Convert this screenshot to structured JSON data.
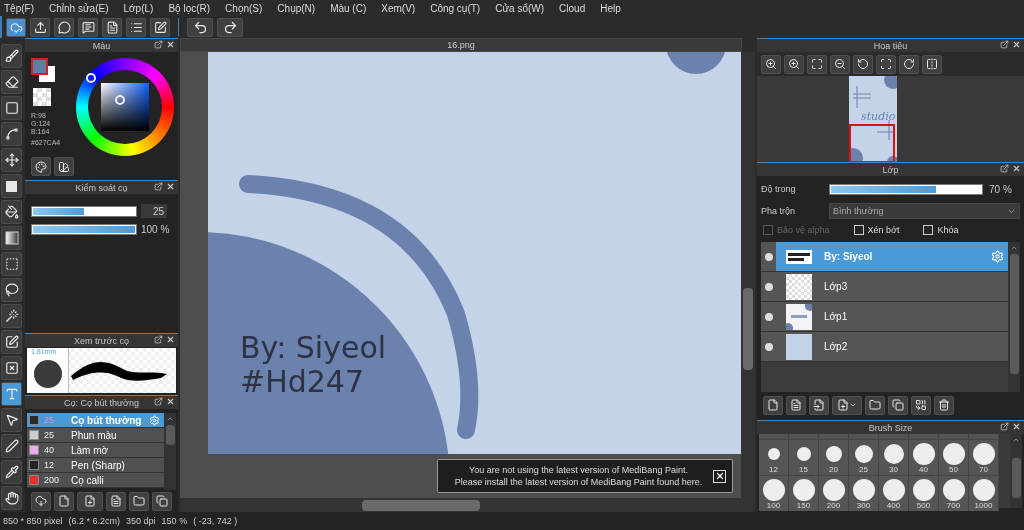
{
  "menu": [
    "Tệp(F)",
    "Chỉnh sửa(E)",
    "Lớp(L)",
    "Bộ lọc(R)",
    "Chọn(S)",
    "Chụp(N)",
    "Màu (C)",
    "Xem(V)",
    "Công cụ(T)",
    "Cửa sổ(W)",
    "Cloud",
    "Help"
  ],
  "tools": [
    {
      "kind": "brush",
      "selected": false
    },
    {
      "kind": "eraser",
      "selected": false
    },
    {
      "kind": "shape",
      "selected": false
    },
    {
      "kind": "curve",
      "selected": false
    },
    {
      "kind": "move",
      "selected": false
    },
    {
      "kind": "fill",
      "selected": false
    },
    {
      "kind": "bucket",
      "selected": false
    },
    {
      "kind": "gradient",
      "selected": false
    },
    {
      "kind": "select",
      "selected": false
    },
    {
      "kind": "lasso",
      "selected": false
    },
    {
      "kind": "wand",
      "selected": false
    },
    {
      "kind": "select_pen",
      "selected": false
    },
    {
      "kind": "select_eraser",
      "selected": false
    },
    {
      "kind": "text",
      "selected": true
    },
    {
      "kind": "operation",
      "selected": false
    },
    {
      "kind": "pen",
      "selected": false
    },
    {
      "kind": "pipette",
      "selected": false
    },
    {
      "kind": "hand",
      "selected": false
    }
  ],
  "color_panel": {
    "title": "Màu",
    "hex": "#627CA4",
    "r": "R:98",
    "g": "G:124",
    "b": "B:164"
  },
  "brush_control": {
    "title": "Kiểm soát cọ",
    "size": {
      "level": 0.5,
      "value": "25"
    },
    "opacity": {
      "level": 1,
      "value": "100 %"
    }
  },
  "brush_preview": {
    "title": "Xem trước cọ",
    "size_label": "1.81mm"
  },
  "brush_list": {
    "title": "Cọ: Cọ bút thường",
    "items": [
      {
        "size": "25",
        "name": "Cọ bút thường",
        "color": "#2a2a2a",
        "selected": true
      },
      {
        "size": "25",
        "name": "Phun màu",
        "color": "#cccccc",
        "selected": false
      },
      {
        "size": "40",
        "name": "Làm mờ",
        "color": "#f0a8f0",
        "selected": false
      },
      {
        "size": "12",
        "name": "Pen (Sharp)",
        "color": "#222222",
        "selected": false
      },
      {
        "size": "200",
        "name": "Cọ calli",
        "color": "#e83030",
        "selected": false
      }
    ]
  },
  "canvas": {
    "tab": "16.png",
    "texts": [
      "By: Siyeol",
      "#Hd247"
    ]
  },
  "notification": {
    "lines": [
      "You are not using the latest version of MediBang Paint.",
      "Please install the latest version of MediBang Paint found here."
    ]
  },
  "navigator": {
    "title": "Hoa tiêu",
    "thumbnail_text": "studio"
  },
  "layers": {
    "title": "Lớp",
    "opacity": {
      "label": "Độ trong",
      "level": 0.7,
      "value": "70 %"
    },
    "blend": {
      "label": "Pha trộn",
      "value": "Bình thường"
    },
    "options": [
      {
        "label": "Bảo vệ alpha",
        "checked": false,
        "disabled": true
      },
      {
        "label": "Xén bớt",
        "checked": false,
        "disabled": false
      },
      {
        "label": "Khóa",
        "checked": false,
        "disabled": false
      }
    ],
    "items": [
      {
        "name": "By: Siyeol",
        "kind": "text",
        "selected": true
      },
      {
        "name": "Lớp3",
        "kind": "empty",
        "selected": false
      },
      {
        "name": "Lớp1",
        "kind": "art",
        "selected": false
      },
      {
        "name": "Lớp2",
        "kind": "fill",
        "selected": false
      }
    ]
  },
  "brush_size": {
    "title": "Brush Size",
    "sizes": [
      "12",
      "15",
      "20",
      "25",
      "30",
      "40",
      "50",
      "70",
      "100",
      "150",
      "200",
      "300",
      "400",
      "500",
      "700",
      "1000"
    ]
  },
  "status_bar": [
    "850 * 850 pixel",
    "(6.2 * 6.2cm)",
    "350 dpi",
    "150 %",
    "( -23, 742 )"
  ]
}
